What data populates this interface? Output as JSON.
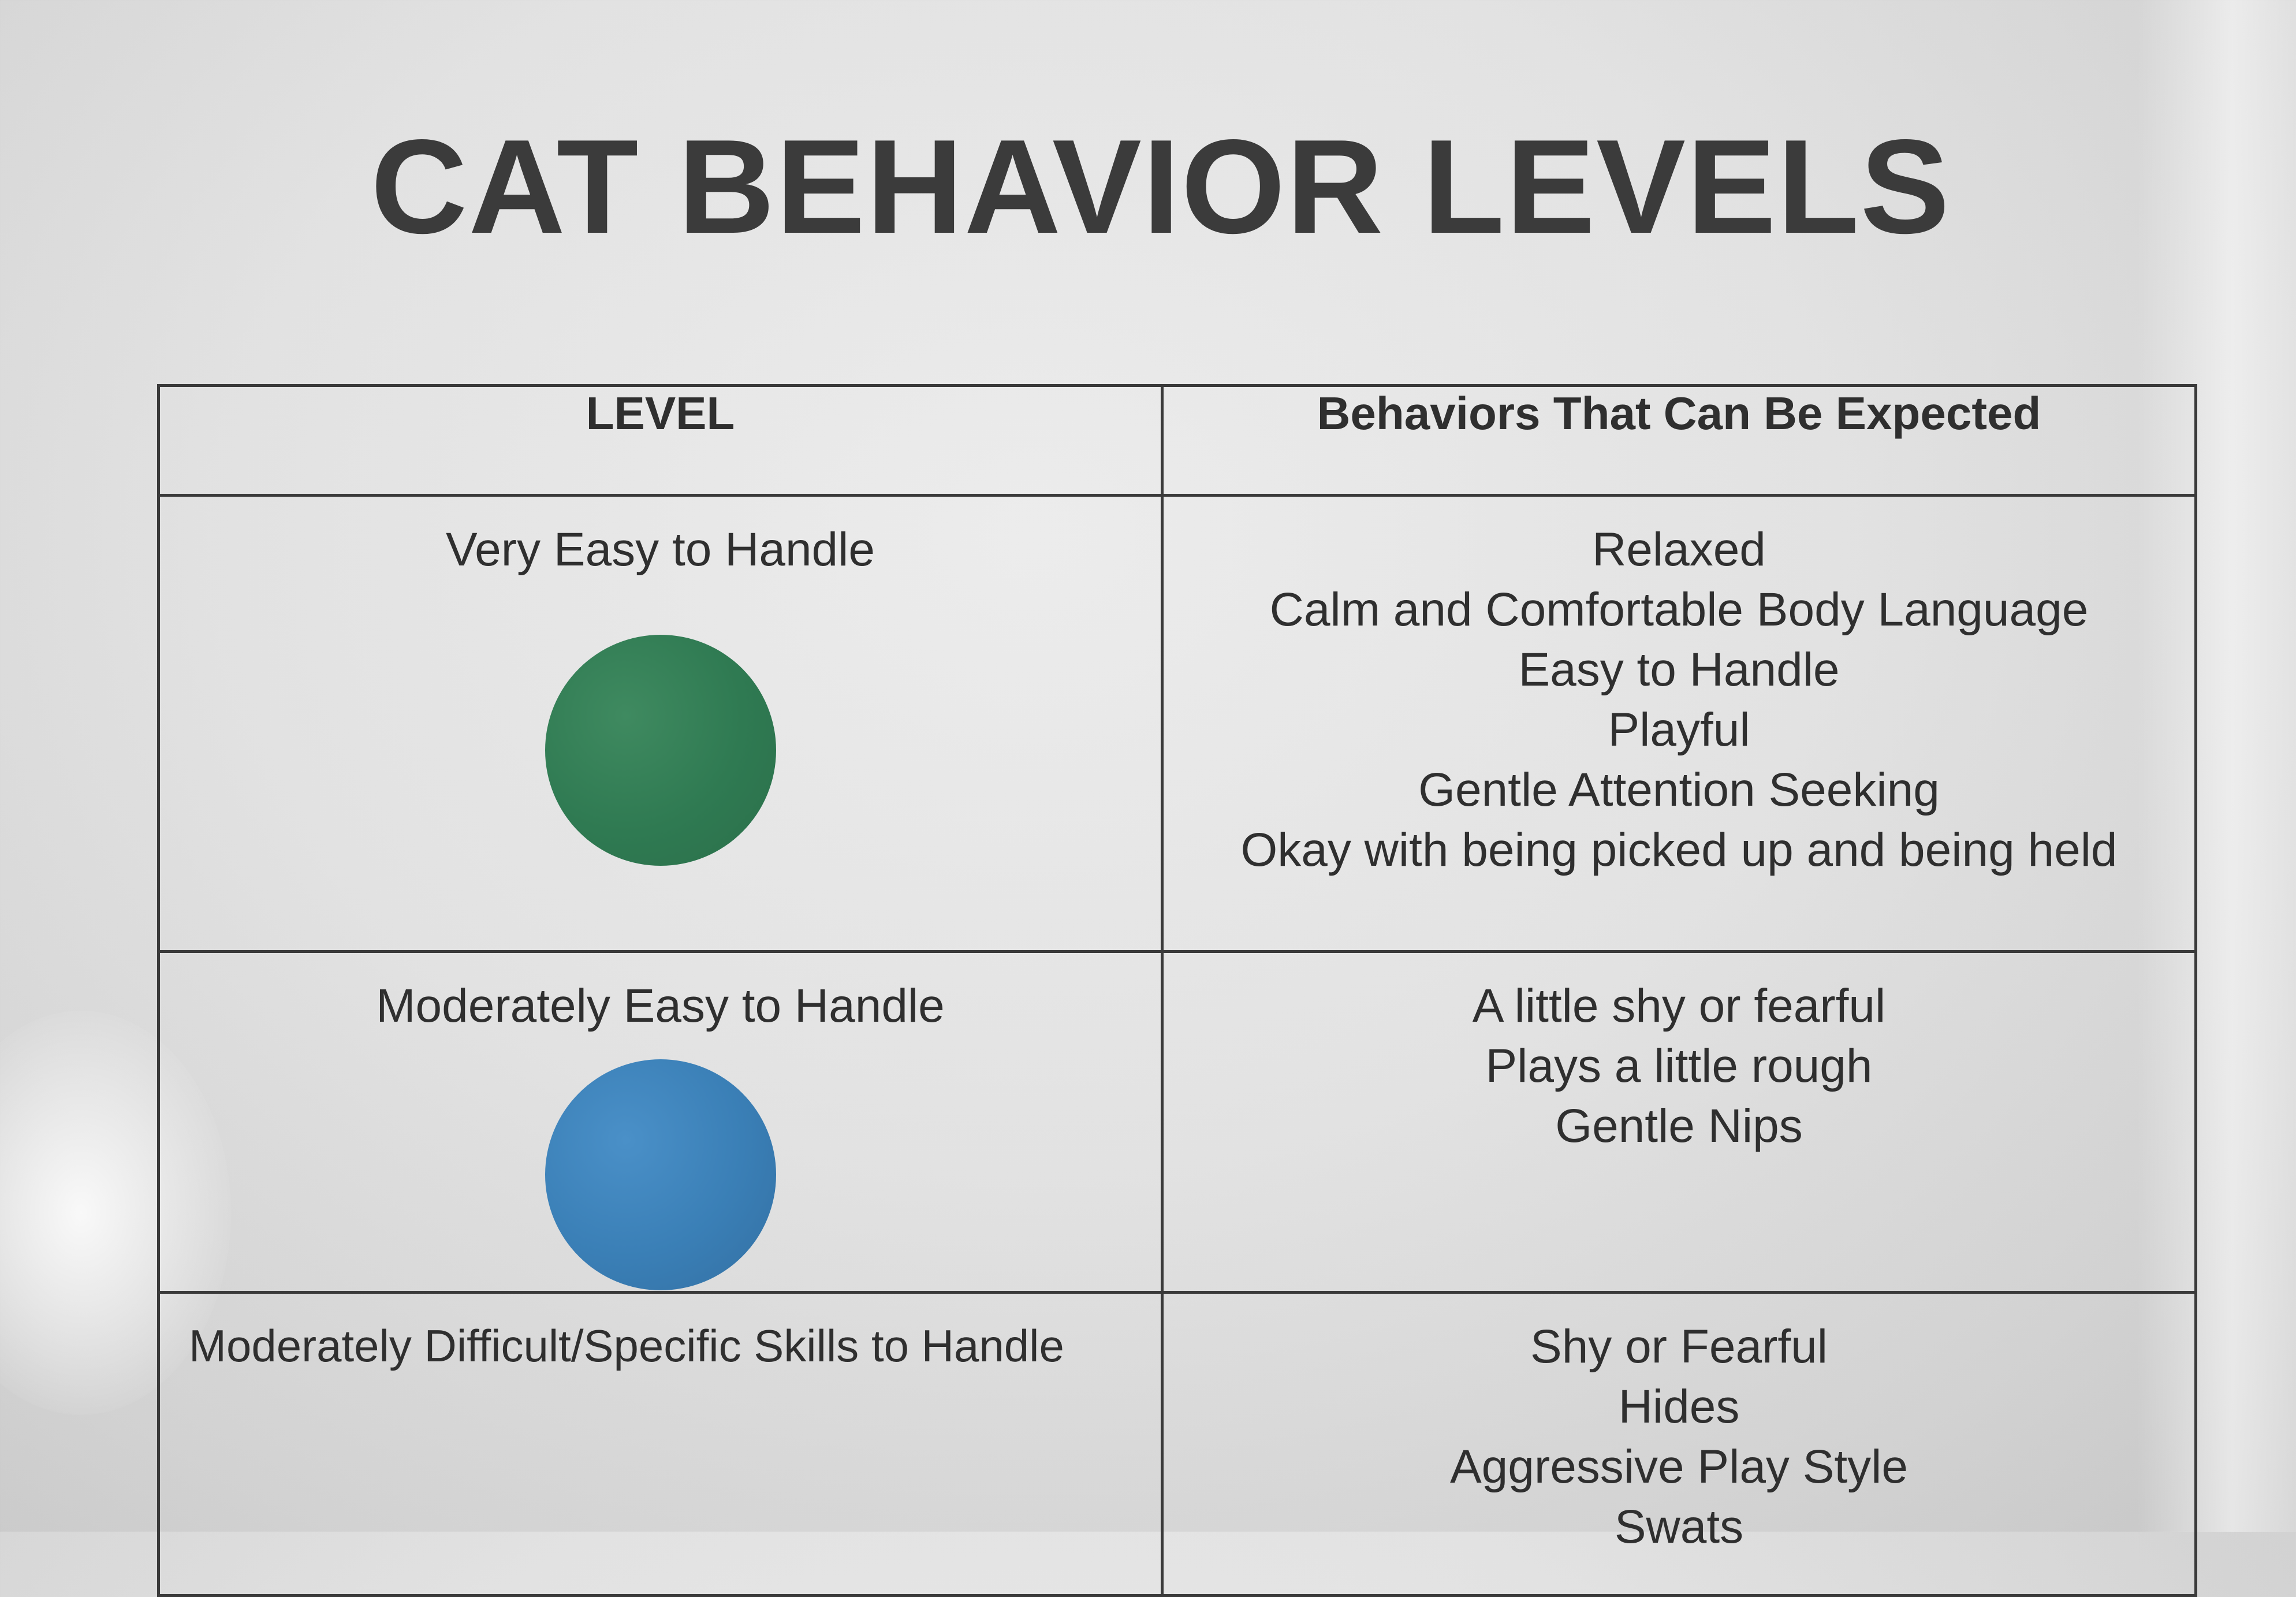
{
  "title": "CAT BEHAVIOR LEVELS",
  "table": {
    "headers": {
      "level": "LEVEL",
      "behaviors": "Behaviors That Can Be Expected"
    },
    "rows": [
      {
        "level": "Very Easy to Handle",
        "color": "#2f7a52",
        "color_name": "green",
        "behaviors": [
          "Relaxed",
          "Calm and Comfortable Body Language",
          "Easy to Handle",
          "Playful",
          "Gentle Attention Seeking",
          "Okay with being picked up and being held"
        ]
      },
      {
        "level": "Moderately Easy to Handle",
        "color": "#3a7fb6",
        "color_name": "blue",
        "behaviors": [
          "A little shy or fearful",
          "Plays a little rough",
          "Gentle Nips"
        ]
      },
      {
        "level": "Moderately Difficult/Specific Skills to Handle",
        "behaviors": [
          "Shy or Fearful",
          "Hides",
          "Aggressive Play Style",
          "Swats"
        ]
      }
    ]
  }
}
